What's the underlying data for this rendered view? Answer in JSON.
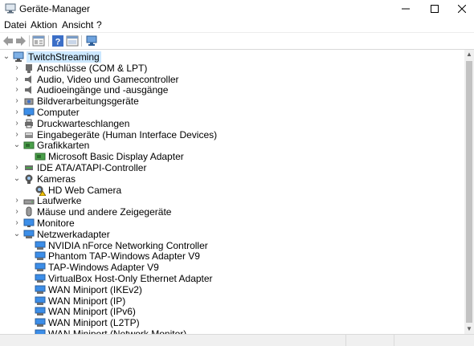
{
  "window": {
    "title": "Geräte-Manager"
  },
  "menu": [
    "Datei",
    "Aktion",
    "Ansicht",
    "?"
  ],
  "tree": [
    {
      "label": "TwitchStreaming",
      "level": 0,
      "expander": "expanded",
      "icon": "computer-root-icon",
      "selected": true
    },
    {
      "label": "Anschlüsse (COM & LPT)",
      "level": 1,
      "expander": "collapsed",
      "icon": "port-icon"
    },
    {
      "label": "Audio, Video und Gamecontroller",
      "level": 1,
      "expander": "collapsed",
      "icon": "speaker-icon"
    },
    {
      "label": "Audioeingänge und -ausgänge",
      "level": 1,
      "expander": "collapsed",
      "icon": "speaker-icon"
    },
    {
      "label": "Bildverarbeitungsgeräte",
      "level": 1,
      "expander": "collapsed",
      "icon": "imaging-icon"
    },
    {
      "label": "Computer",
      "level": 1,
      "expander": "collapsed",
      "icon": "monitor-icon"
    },
    {
      "label": "Druckwarteschlangen",
      "level": 1,
      "expander": "collapsed",
      "icon": "printer-icon"
    },
    {
      "label": "Eingabegeräte (Human Interface Devices)",
      "level": 1,
      "expander": "collapsed",
      "icon": "hid-icon"
    },
    {
      "label": "Grafikkarten",
      "level": 1,
      "expander": "expanded",
      "icon": "display-adapter-icon"
    },
    {
      "label": "Microsoft Basic Display Adapter",
      "level": 2,
      "expander": "none",
      "icon": "display-adapter-icon"
    },
    {
      "label": "IDE ATA/ATAPI-Controller",
      "level": 1,
      "expander": "collapsed",
      "icon": "ide-icon"
    },
    {
      "label": "Kameras",
      "level": 1,
      "expander": "expanded",
      "icon": "camera-icon"
    },
    {
      "label": "HD Web Camera",
      "level": 2,
      "expander": "none",
      "icon": "camera-warning-icon"
    },
    {
      "label": "Laufwerke",
      "level": 1,
      "expander": "collapsed",
      "icon": "drive-icon"
    },
    {
      "label": "Mäuse und andere Zeigegeräte",
      "level": 1,
      "expander": "collapsed",
      "icon": "mouse-icon"
    },
    {
      "label": "Monitore",
      "level": 1,
      "expander": "collapsed",
      "icon": "monitor-icon"
    },
    {
      "label": "Netzwerkadapter",
      "level": 1,
      "expander": "expanded",
      "icon": "network-icon"
    },
    {
      "label": "NVIDIA nForce Networking Controller",
      "level": 2,
      "expander": "none",
      "icon": "network-icon"
    },
    {
      "label": "Phantom TAP-Windows Adapter V9",
      "level": 2,
      "expander": "none",
      "icon": "network-icon"
    },
    {
      "label": "TAP-Windows Adapter V9",
      "level": 2,
      "expander": "none",
      "icon": "network-icon"
    },
    {
      "label": "VirtualBox Host-Only Ethernet Adapter",
      "level": 2,
      "expander": "none",
      "icon": "network-icon"
    },
    {
      "label": "WAN Miniport (IKEv2)",
      "level": 2,
      "expander": "none",
      "icon": "network-icon"
    },
    {
      "label": "WAN Miniport (IP)",
      "level": 2,
      "expander": "none",
      "icon": "network-icon"
    },
    {
      "label": "WAN Miniport (IPv6)",
      "level": 2,
      "expander": "none",
      "icon": "network-icon"
    },
    {
      "label": "WAN Miniport (L2TP)",
      "level": 2,
      "expander": "none",
      "icon": "network-icon"
    },
    {
      "label": "WAN Miniport (Network Monitor)",
      "level": 2,
      "expander": "none",
      "icon": "network-icon"
    }
  ]
}
